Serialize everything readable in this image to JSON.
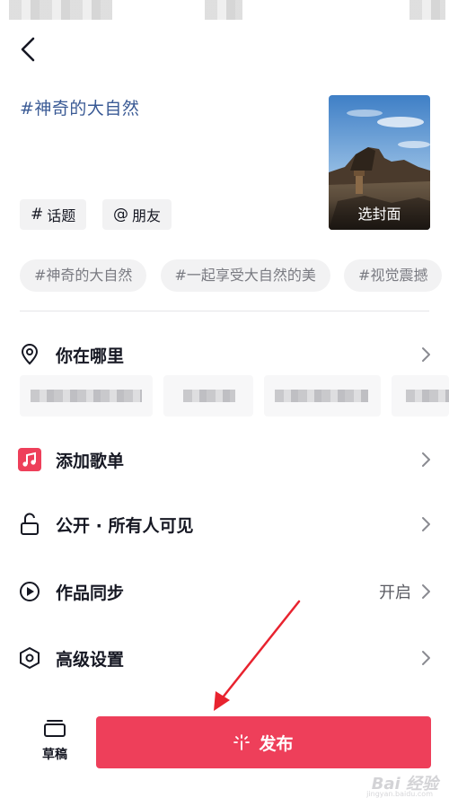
{
  "caption": "#神奇的大自然",
  "chips": {
    "topic": {
      "symbol": "#",
      "label": "话题"
    },
    "friend": {
      "symbol": "@",
      "label": "朋友"
    }
  },
  "cover": {
    "label": "选封面"
  },
  "suggested_tags": [
    "#神奇的大自然",
    "#一起享受大自然的美",
    "#视觉震撼"
  ],
  "rows": {
    "location": {
      "label": "你在哪里",
      "icon": "location-pin-icon"
    },
    "playlist": {
      "label": "添加歌单",
      "icon": "music-note-icon"
    },
    "visibility": {
      "label": "公开 · 所有人可见",
      "icon": "unlock-icon"
    },
    "sync": {
      "label": "作品同步",
      "value": "开启",
      "icon": "sync-icon"
    },
    "advanced": {
      "label": "高级设置",
      "icon": "settings-hexagon-icon"
    }
  },
  "bottom": {
    "draft_label": "草稿",
    "publish_label": "发布"
  },
  "watermark": {
    "text": "Bai 经验",
    "sub": "jingyan.baidu.com"
  },
  "colors": {
    "accent": "#ee3f5a",
    "caption": "#3a5a95",
    "music_icon_bg": "#ee3f5a"
  }
}
